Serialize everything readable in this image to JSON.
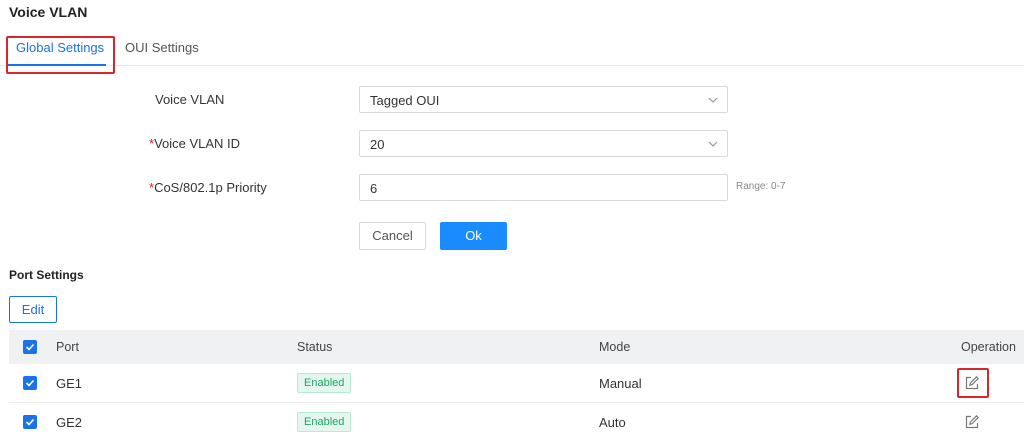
{
  "page": {
    "title": "Voice VLAN"
  },
  "tabs": [
    {
      "label": "Global Settings",
      "active": true
    },
    {
      "label": "OUI Settings",
      "active": false
    }
  ],
  "form": {
    "voice_vlan": {
      "label": "Voice VLAN",
      "value": "Tagged OUI"
    },
    "voice_vlan_id": {
      "required_mark": "*",
      "label": "Voice VLAN ID",
      "value": "20"
    },
    "cos_priority": {
      "required_mark": "*",
      "label": "CoS/802.1p Priority",
      "value": "6",
      "hint": "Range: 0-7"
    },
    "cancel_label": "Cancel",
    "ok_label": "Ok"
  },
  "port_settings": {
    "title": "Port Settings",
    "edit_label": "Edit",
    "columns": {
      "port": "Port",
      "status": "Status",
      "mode": "Mode",
      "operation": "Operation"
    },
    "rows": [
      {
        "port": "GE1",
        "status": "Enabled",
        "mode": "Manual",
        "checked": true
      },
      {
        "port": "GE2",
        "status": "Enabled",
        "mode": "Auto",
        "checked": true
      }
    ]
  },
  "colors": {
    "accent": "#1a73e8",
    "primary_button": "#1a8cff",
    "highlight": "#d9262c",
    "status_enabled": "#21a366"
  },
  "icons": {
    "select_arrow": "chevron-down-icon",
    "row_action": "edit-icon",
    "checkbox": "checkmark-icon"
  }
}
